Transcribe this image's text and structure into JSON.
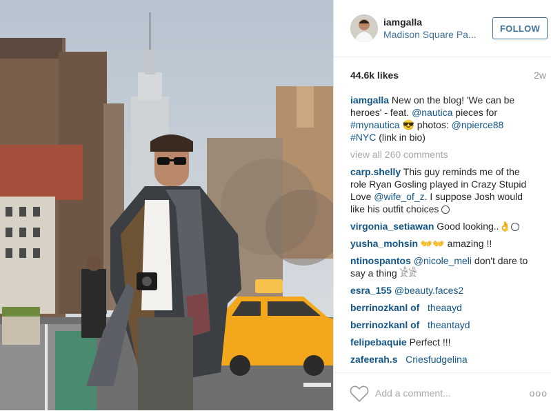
{
  "post": {
    "username": "iamgalla",
    "location": "Madison Square Pa...",
    "follow_label": "FOLLOW",
    "likes": "44.6k likes",
    "age": "2w"
  },
  "caption": {
    "user": "iamgalla",
    "text1": " New on the blog! 'We can be heroes' - feat. ",
    "tag1": "@nautica",
    "text2": " pieces for ",
    "tag2": "#mynautica",
    "text3": " 😎 photos: ",
    "tag3": "@npierce88",
    "tag4": "#NYC",
    "text4": " (link in bio)"
  },
  "view_all": "view all 260 comments",
  "comments": [
    {
      "user": "carp.shelly",
      "a": " This guy reminds me of the role Ryan Gosling played in Crazy Stupid Love ",
      "tag": "@wife_of_z",
      "b": ". I suppose Josh would like his outfit choices "
    },
    {
      "user": "virgonia_setiawan",
      "text": " Good looking..👌"
    },
    {
      "user": "yusha_mohsin",
      "text": "  👐👐 amazing !!"
    },
    {
      "user": "ntinospantos",
      "tag": "@nicole_meli",
      "text": " don't dare to say a thing 𓀀𓀀"
    },
    {
      "user": "esra_155",
      "tag": "@beauty.faces2"
    },
    {
      "user": "berrinozkanl of",
      "tag": "theaayd"
    },
    {
      "user": "berrinozkanl of",
      "tag": "theantayd"
    },
    {
      "user": "felipebaquie",
      "text": " Perfect !!!"
    },
    {
      "user": "zafeerah.s",
      "tag": "Criesfudgelina"
    }
  ],
  "footer": {
    "placeholder": "Add a comment...",
    "more": "ooo"
  },
  "icons": [
    "heart-icon",
    "more-options-icon",
    "smile-icon"
  ]
}
